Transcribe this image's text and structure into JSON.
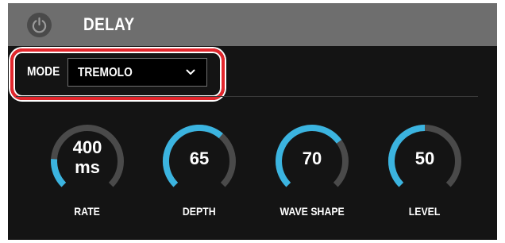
{
  "header": {
    "title": "DELAY",
    "power_icon": "power-icon"
  },
  "mode": {
    "label": "MODE",
    "value": "TREMOLO",
    "chevron_icon": "chevron-down-icon"
  },
  "colors": {
    "accent": "#3bb4e0",
    "track": "#4a4a4a",
    "highlight": "#e3262c",
    "header_bg": "#6e6e6e",
    "panel_bg": "#141414"
  },
  "knobs": [
    {
      "label": "RATE",
      "value_line1": "400",
      "value_line2": "ms",
      "level": 0.18
    },
    {
      "label": "DEPTH",
      "value": "65",
      "level": 0.65
    },
    {
      "label": "WAVE SHAPE",
      "value": "70",
      "level": 0.7
    },
    {
      "label": "LEVEL",
      "value": "50",
      "level": 0.5
    }
  ]
}
